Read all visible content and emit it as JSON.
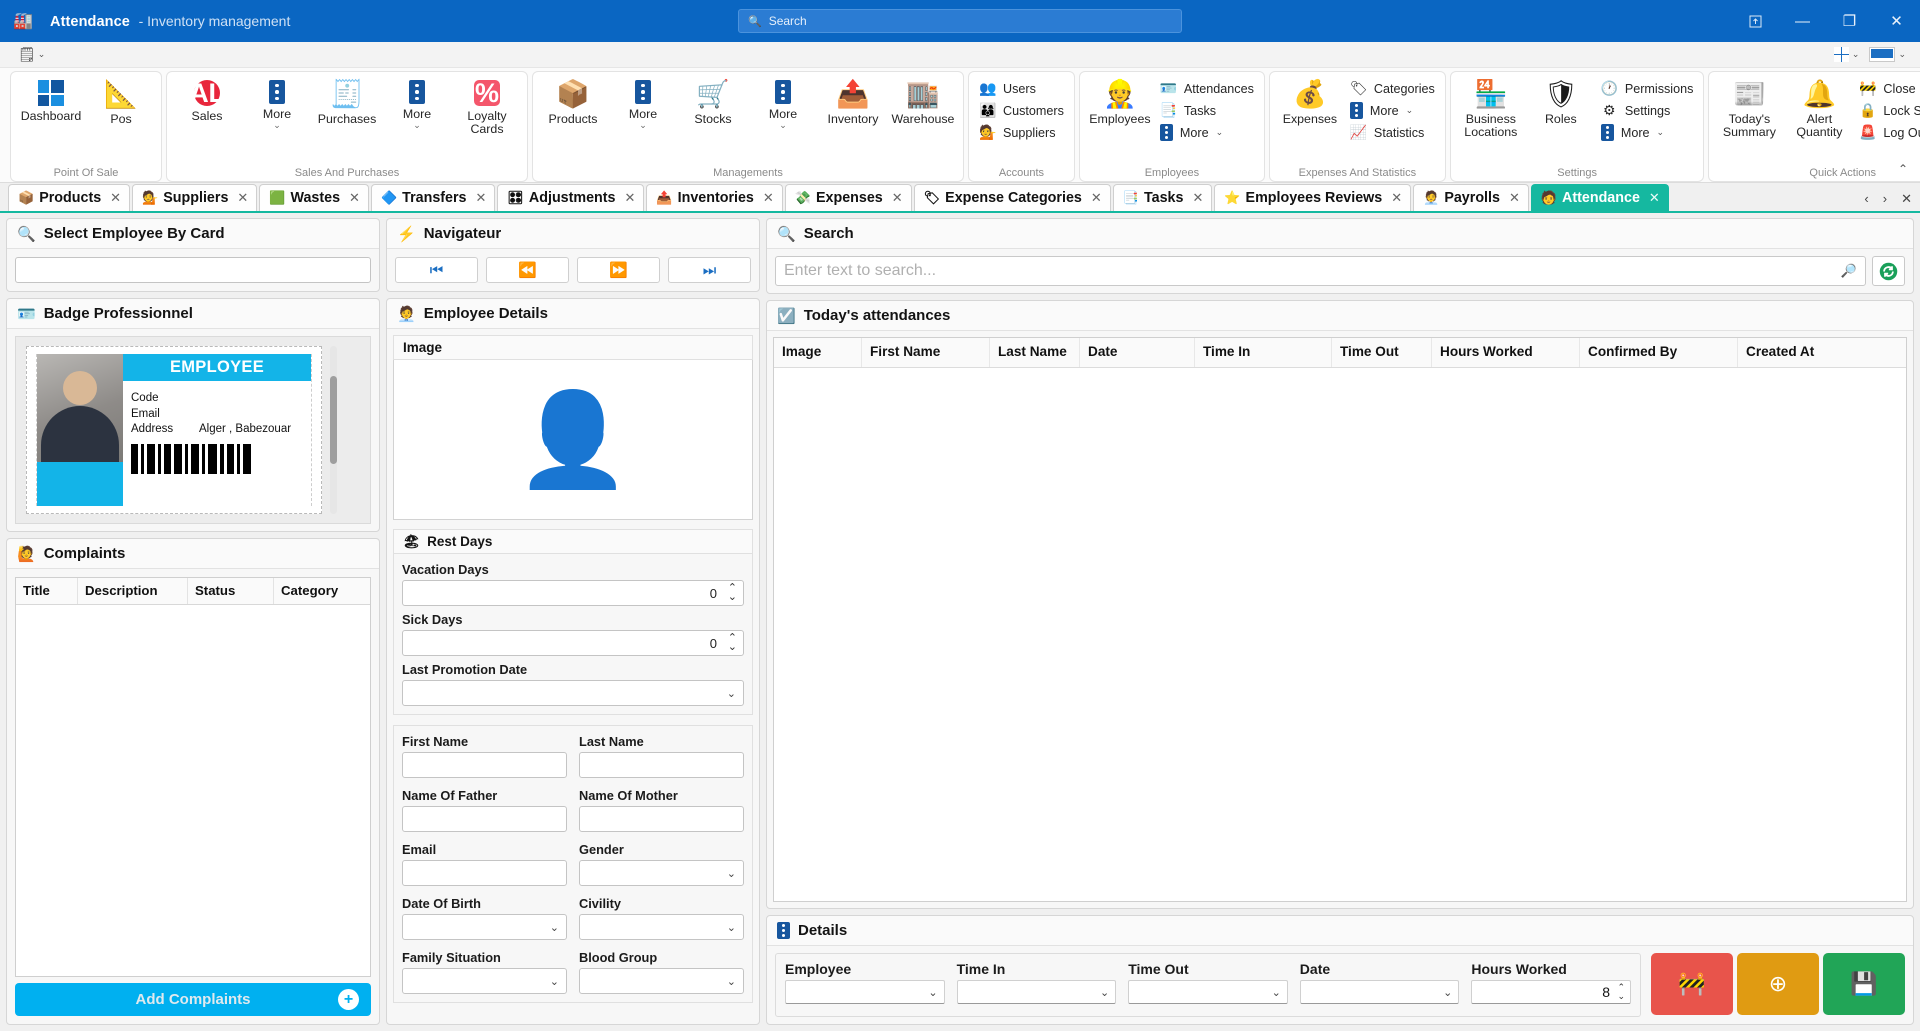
{
  "titlebar": {
    "app_icon": "factory-icon",
    "title": "Attendance",
    "subtitle": "- Inventory management",
    "search_placeholder": "Search",
    "buttons": {
      "restore_down": "⊡",
      "minimize": "—",
      "maximize": "❐",
      "close": "✕"
    }
  },
  "quickaccess": {
    "menu_icon": "list-menu-icon",
    "caret": "⌄"
  },
  "ribbon": {
    "groups": [
      {
        "name": "Point Of Sale",
        "big": [
          {
            "label": "Dashboard",
            "icon": "dashboard-icon"
          },
          {
            "label": "Pos",
            "icon": "pos-icon"
          }
        ],
        "small": []
      },
      {
        "name": "Sales And Purchases",
        "big": [
          {
            "label": "Sales",
            "icon": "sale-badge-icon"
          },
          {
            "label": "More",
            "icon": "more-dots-icon",
            "chevron": "⌄"
          },
          {
            "label": "Purchases",
            "icon": "purchases-icon"
          },
          {
            "label": "More",
            "icon": "more-dots-icon",
            "chevron": "⌄"
          },
          {
            "label": "Loyalty Cards",
            "icon": "percent-icon"
          }
        ],
        "small": []
      },
      {
        "name": "Managements",
        "big": [
          {
            "label": "Products",
            "icon": "box-icon"
          },
          {
            "label": "More",
            "icon": "more-dots-icon",
            "chevron": "⌄"
          },
          {
            "label": "Stocks",
            "icon": "cart-icon"
          },
          {
            "label": "More",
            "icon": "more-dots-icon",
            "chevron": "⌄"
          },
          {
            "label": "Inventory",
            "icon": "inventory-icon"
          },
          {
            "label": "Warehouse",
            "icon": "warehouse-icon"
          }
        ],
        "small": []
      },
      {
        "name": "Accounts",
        "big": [],
        "small": [
          {
            "label": "Users",
            "icon": "users-icon"
          },
          {
            "label": "Customers",
            "icon": "customers-icon"
          },
          {
            "label": "Suppliers",
            "icon": "supplier-icon"
          }
        ]
      },
      {
        "name": "Employees",
        "big": [
          {
            "label": "Employees",
            "icon": "employee-icon"
          }
        ],
        "small": [
          {
            "label": "Attendances",
            "icon": "attendance-icon"
          },
          {
            "label": "Tasks",
            "icon": "tasks-icon"
          },
          {
            "label": "More",
            "icon": "more-dots-icon",
            "chevron": "⌄"
          }
        ]
      },
      {
        "name": "Expenses And Statistics",
        "big": [
          {
            "label": "Expenses",
            "icon": "money-bag-icon"
          }
        ],
        "small": [
          {
            "label": "Categories",
            "icon": "tag-icon"
          },
          {
            "label": "More",
            "icon": "more-dots-icon",
            "chevron": "⌄"
          },
          {
            "label": "Statistics",
            "icon": "chart-icon"
          }
        ]
      },
      {
        "name": "Settings",
        "big": [
          {
            "label": "Business Locations",
            "icon": "store-icon"
          },
          {
            "label": "Roles",
            "icon": "shield-check-icon"
          }
        ],
        "small": [
          {
            "label": "Permissions",
            "icon": "permissions-icon"
          },
          {
            "label": "Settings",
            "icon": "gear-icon"
          },
          {
            "label": "More",
            "icon": "more-dots-icon",
            "chevron": "⌄"
          }
        ]
      },
      {
        "name": "Quick Actions",
        "big": [
          {
            "label": "Today's Summary",
            "icon": "summary-icon"
          },
          {
            "label": "Alert Quantity",
            "icon": "bell-icon"
          }
        ],
        "small": [
          {
            "label": "Close Register",
            "icon": "close-register-icon"
          },
          {
            "label": "Lock Screen",
            "icon": "lock-icon"
          },
          {
            "label": "Log Out",
            "icon": "logout-alarm-icon"
          }
        ]
      }
    ],
    "collapse_caret": "⌃"
  },
  "tabs": [
    {
      "label": "Products",
      "icon": "box-icon",
      "active": false
    },
    {
      "label": "Suppliers",
      "icon": "supplier-icon",
      "active": false
    },
    {
      "label": "Wastes",
      "icon": "waste-icon",
      "active": false
    },
    {
      "label": "Transfers",
      "icon": "transfer-icon",
      "active": false
    },
    {
      "label": "Adjustments",
      "icon": "adjustments-icon",
      "active": false
    },
    {
      "label": "Inventories",
      "icon": "inventory-icon",
      "active": false
    },
    {
      "label": "Expenses",
      "icon": "expenses-icon",
      "active": false
    },
    {
      "label": "Expense Categories",
      "icon": "tag-icon",
      "active": false
    },
    {
      "label": "Tasks",
      "icon": "tasks-icon",
      "active": false
    },
    {
      "label": "Employees Reviews",
      "icon": "star-icon",
      "active": false
    },
    {
      "label": "Payrolls",
      "icon": "payroll-icon",
      "active": false
    },
    {
      "label": "Attendance",
      "icon": "attendance-icon",
      "active": true
    }
  ],
  "tabnav": {
    "prev": "‹",
    "next": "›",
    "close": "✕",
    "close_symbol": "✕"
  },
  "left": {
    "select_card": {
      "title": "Select Employee By Card",
      "icon": "search-icon",
      "input_value": "",
      "placeholder": ""
    },
    "badge": {
      "title": "Badge Professionnel",
      "icon": "id-badge-icon",
      "header": "EMPLOYEE",
      "rows": [
        {
          "key": "Code",
          "value": ""
        },
        {
          "key": "Email",
          "value": ""
        },
        {
          "key": "Address",
          "value": "Alger , Babezouar"
        }
      ]
    },
    "complaints": {
      "title": "Complaints",
      "icon": "complaint-icon",
      "columns": [
        "Title",
        "Description",
        "Status",
        "Category"
      ],
      "rows": [],
      "add_label": "Add Complaints",
      "add_icon": "plus-icon"
    }
  },
  "middle": {
    "navigator": {
      "title": "Navigateur",
      "icon": "lightning-icon",
      "buttons": [
        {
          "name": "first",
          "glyph": "⏮"
        },
        {
          "name": "previous",
          "glyph": "⏪"
        },
        {
          "name": "next",
          "glyph": "⏩"
        },
        {
          "name": "last",
          "glyph": "⏭"
        }
      ]
    },
    "employee_details": {
      "title": "Employee Details",
      "icon": "employee-check-icon",
      "image_label": "Image",
      "image_icon": "user-avatar-check-icon"
    },
    "rest_days": {
      "title": "Rest Days",
      "icon": "beach-icon",
      "fields": [
        {
          "label": "Vacation Days",
          "value": "0",
          "type": "spinner"
        },
        {
          "label": "Sick Days",
          "value": "0",
          "type": "spinner"
        },
        {
          "label": "Last Promotion Date",
          "value": "",
          "type": "select"
        }
      ]
    },
    "personal": [
      {
        "label": "First Name",
        "value": "",
        "type": "text"
      },
      {
        "label": "Last Name",
        "value": "",
        "type": "text"
      },
      {
        "label": "Name Of Father",
        "value": "",
        "type": "text"
      },
      {
        "label": "Name Of Mother",
        "value": "",
        "type": "text"
      },
      {
        "label": "Email",
        "value": "",
        "type": "text"
      },
      {
        "label": "Gender",
        "value": "",
        "type": "select"
      },
      {
        "label": "Date Of Birth",
        "value": "",
        "type": "select"
      },
      {
        "label": "Civility",
        "value": "",
        "type": "select"
      },
      {
        "label": "Family Situation",
        "value": "",
        "type": "select"
      },
      {
        "label": "Blood Group",
        "value": "",
        "type": "select"
      }
    ]
  },
  "right": {
    "search": {
      "title": "Search",
      "icon": "search-icon",
      "placeholder": "Enter text to search...",
      "value": "",
      "search_icon": "magnifier-icon",
      "refresh_icon": "refresh-icon"
    },
    "attendances": {
      "title": "Today's attendances",
      "icon": "checkbox-icon",
      "columns": [
        "Image",
        "First Name",
        "Last Name",
        "Date",
        "Time In",
        "Time Out",
        "Hours Worked",
        "Confirmed By",
        "Created At"
      ],
      "rows": []
    },
    "details": {
      "title": "Details",
      "icon": "more-dots-icon",
      "fields": [
        {
          "label": "Employee",
          "value": "",
          "type": "select"
        },
        {
          "label": "Time In",
          "value": "",
          "type": "select"
        },
        {
          "label": "Time Out",
          "value": "",
          "type": "select"
        },
        {
          "label": "Date",
          "value": "",
          "type": "select"
        },
        {
          "label": "Hours Worked",
          "value": "8",
          "type": "spinner"
        }
      ],
      "buttons": [
        {
          "name": "close-register-button",
          "icon": "close-register-icon",
          "color": "#e8544b"
        },
        {
          "name": "add-button",
          "icon": "plus-icon",
          "color": "#e09b12"
        },
        {
          "name": "save-button",
          "icon": "save-icon",
          "color": "#21a557"
        }
      ]
    }
  },
  "colors": {
    "titlebar": "#0a66c2",
    "accent_tab": "#15b8a0",
    "cyan": "#13b4e8",
    "red": "#e8544b",
    "orange": "#e09b12",
    "green": "#21a557"
  }
}
